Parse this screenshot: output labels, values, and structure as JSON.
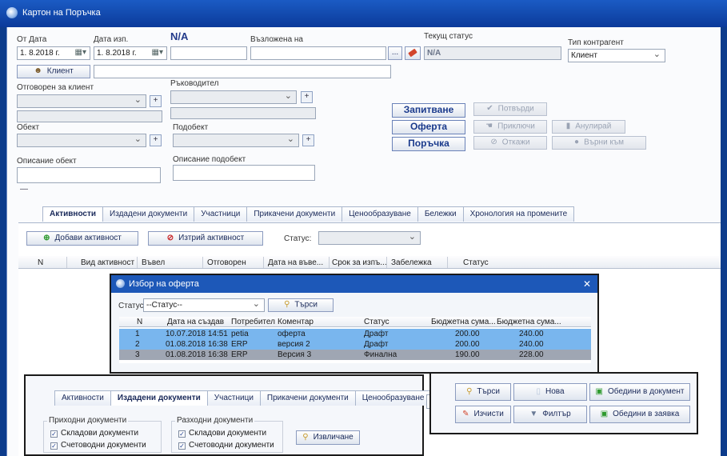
{
  "window": {
    "title": "Картон на Поръчка"
  },
  "header": {
    "from_date_label": "От Дата",
    "from_date_value": "1. 8.2018 г.",
    "exec_date_label": "Дата изп.",
    "exec_date_value": "1. 8.2018 г.",
    "na_label": "N/A",
    "assigned_to_label": "Възложена на",
    "current_status_label": "Текущ статус",
    "current_status_value": "N/A",
    "contractor_type_label": "Тип контрагент",
    "contractor_type_value": "Клиент",
    "client_button": "Клиент",
    "ellipsis": "...",
    "responsible_label": "Отговорен за клиент",
    "manager_label": "Ръководител",
    "object_label": "Обект",
    "subobject_label": "Подобект",
    "object_desc_label": "Описание обект",
    "subobject_desc_label": "Описание подобект",
    "plus": "+",
    "dash": "—"
  },
  "actions": {
    "inquiry": "Запитване",
    "offer": "Оферта",
    "order": "Поръчка",
    "confirm": "Потвърди",
    "finish": "Приключи",
    "cancel_order": "Анулирай",
    "reject": "Откажи",
    "return_to": "Върни към"
  },
  "tabs": [
    "Активности",
    "Издадени документи",
    "Участници",
    "Прикачени документи",
    "Ценообразуване",
    "Бележки",
    "Хронология на промените"
  ],
  "activity_toolbar": {
    "add": "Добави активност",
    "delete": "Изтрий активност",
    "status_label": "Статус:"
  },
  "activity_grid": {
    "columns": [
      "N",
      "Вид активност",
      "Въвел",
      "Отговорен",
      "Дата на въве...",
      "Срок за изпъ...",
      "Забележка",
      "Статус"
    ]
  },
  "offer_dialog": {
    "title": "Избор на оферта",
    "close": "✕",
    "status_label": "Статус",
    "status_value": "--Статус--",
    "search": "Търси",
    "columns": [
      "N",
      "Дата на създав",
      "Потребител",
      "Коментар",
      "Статус",
      "Бюджетна сума...",
      "Бюджетна сума..."
    ],
    "rows": [
      [
        "1",
        "10.07.2018 14:51",
        "petia",
        "оферта",
        "Драфт",
        "200.00",
        "240.00"
      ],
      [
        "2",
        "01.08.2018 16:38",
        "ERP",
        "версия 2",
        "Драфт",
        "200.00",
        "240.00"
      ],
      [
        "3",
        "01.08.2018 16:38",
        "ERP",
        "Версия 3",
        "Финална",
        "190.00",
        "228.00"
      ]
    ]
  },
  "docs_panel": {
    "tabs": [
      "Активности",
      "Издадени документи",
      "Участници",
      "Прикачени документи",
      "Ценообразуване"
    ],
    "incoming_group": "Приходни документи",
    "outgoing_group": "Разходни документи",
    "warehouse_docs": "Складови документи",
    "accounting_docs": "Счетоводни документи",
    "extract": "Извличане"
  },
  "right_toolbar": {
    "search": "Търси",
    "new": "Нова",
    "merge_doc": "Обедини в документ",
    "clear": "Изчисти",
    "filter": "Филтър",
    "merge_request": "Обедини в заявка"
  },
  "colors": {
    "title_bar": "#0b3a9a",
    "row_selected": "#79b6ee",
    "row_selected_dark": "#9fa6b3"
  }
}
